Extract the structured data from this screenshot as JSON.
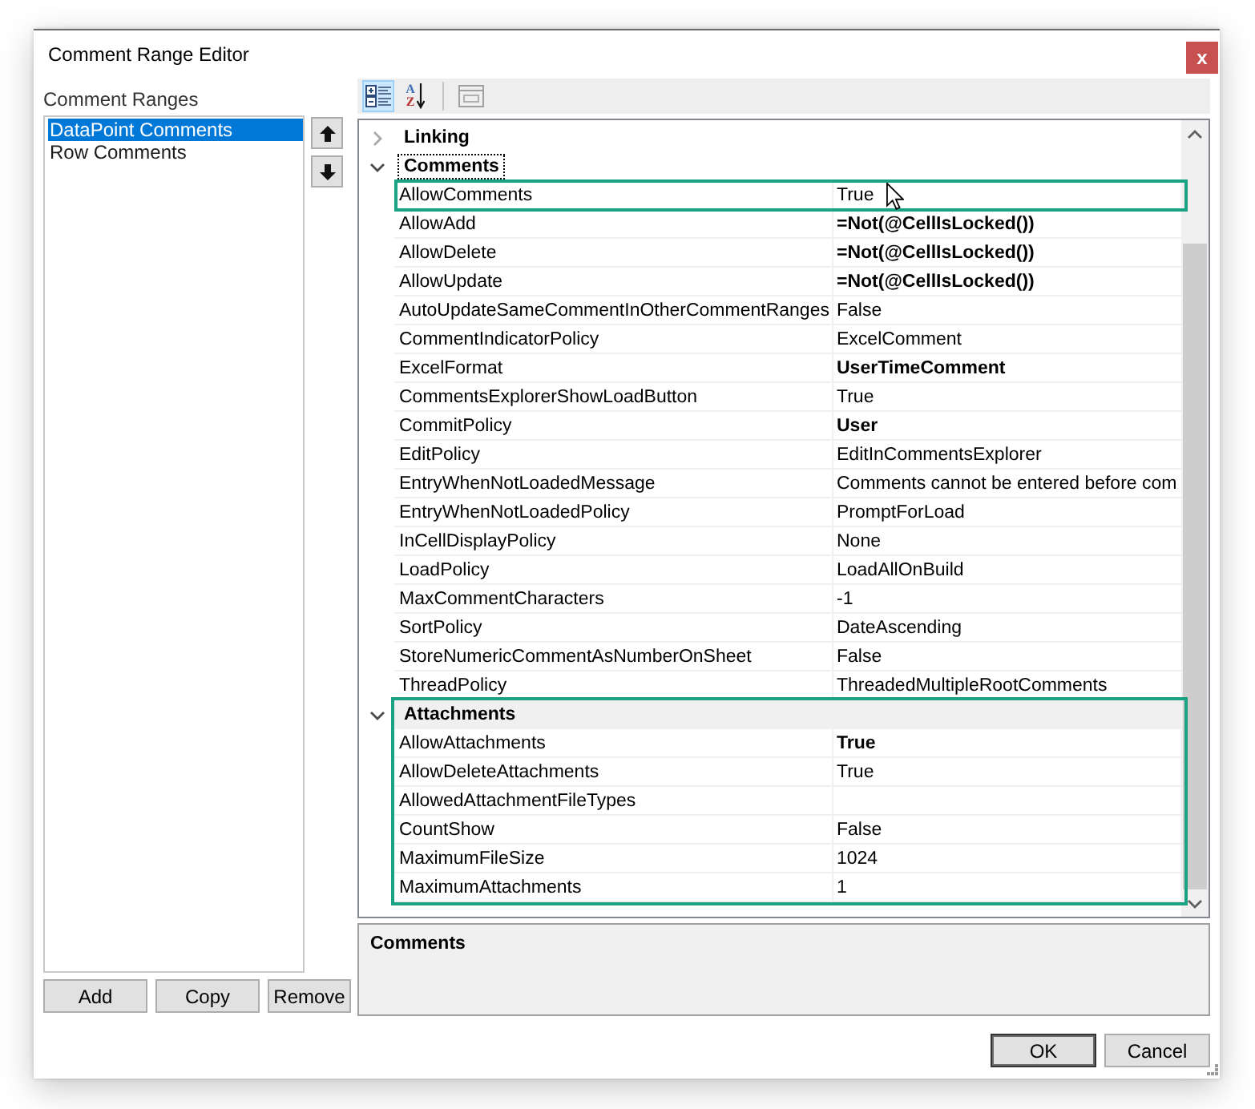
{
  "window": {
    "title": "Comment Range Editor",
    "close_button": "x"
  },
  "comment_ranges": {
    "label": "Comment Ranges",
    "items": [
      {
        "label": "DataPoint Comments",
        "selected": true
      },
      {
        "label": "Row Comments",
        "selected": false
      }
    ],
    "buttons": [
      "Add",
      "Copy",
      "Remove"
    ]
  },
  "toolbar": [
    {
      "kind": "categorized",
      "selected": true,
      "disabled": false
    },
    {
      "kind": "alphabetical",
      "selected": false,
      "disabled": false,
      "glyphs": [
        "A",
        "Z"
      ]
    },
    {
      "kind": "property_pages",
      "selected": false,
      "disabled": true
    }
  ],
  "property_grid": {
    "categories": [
      {
        "name": "Linking",
        "expanded": false,
        "focused": false,
        "shaded": false,
        "highlighted": false
      },
      {
        "name": "Comments",
        "expanded": true,
        "focused": true,
        "shaded": false,
        "highlighted": false,
        "properties": [
          {
            "name": "AllowComments",
            "value": "True",
            "modified": false,
            "highlighted": true
          },
          {
            "name": "AllowAdd",
            "value": "=Not(@CellIsLocked())",
            "modified": true,
            "highlighted": false
          },
          {
            "name": "AllowDelete",
            "value": "=Not(@CellIsLocked())",
            "modified": true,
            "highlighted": false
          },
          {
            "name": "AllowUpdate",
            "value": "=Not(@CellIsLocked())",
            "modified": true,
            "highlighted": false
          },
          {
            "name": "AutoUpdateSameCommentInOtherCommentRanges",
            "value": "False",
            "modified": false,
            "highlighted": false
          },
          {
            "name": "CommentIndicatorPolicy",
            "value": "ExcelComment",
            "modified": false,
            "highlighted": false
          },
          {
            "name": "ExcelFormat",
            "value": "UserTimeComment",
            "modified": true,
            "highlighted": false
          },
          {
            "name": "CommentsExplorerShowLoadButton",
            "value": "True",
            "modified": false,
            "highlighted": false
          },
          {
            "name": "CommitPolicy",
            "value": "User",
            "modified": true,
            "highlighted": false
          },
          {
            "name": "EditPolicy",
            "value": "EditInCommentsExplorer",
            "modified": false,
            "highlighted": false
          },
          {
            "name": "EntryWhenNotLoadedMessage",
            "value": "Comments cannot be entered before com",
            "modified": false,
            "highlighted": false
          },
          {
            "name": "EntryWhenNotLoadedPolicy",
            "value": "PromptForLoad",
            "modified": false,
            "highlighted": false
          },
          {
            "name": "InCellDisplayPolicy",
            "value": "None",
            "modified": false,
            "highlighted": false
          },
          {
            "name": "LoadPolicy",
            "value": "LoadAllOnBuild",
            "modified": false,
            "highlighted": false
          },
          {
            "name": "MaxCommentCharacters",
            "value": "-1",
            "modified": false,
            "highlighted": false
          },
          {
            "name": "SortPolicy",
            "value": "DateAscending",
            "modified": false,
            "highlighted": false
          },
          {
            "name": "StoreNumericCommentAsNumberOnSheet",
            "value": "False",
            "modified": false,
            "highlighted": false
          },
          {
            "name": "ThreadPolicy",
            "value": "ThreadedMultipleRootComments",
            "modified": false,
            "highlighted": false
          }
        ]
      },
      {
        "name": "Attachments",
        "expanded": true,
        "focused": false,
        "shaded": true,
        "highlighted": true,
        "properties": [
          {
            "name": "AllowAttachments",
            "value": "True",
            "modified": true,
            "highlighted": false
          },
          {
            "name": "AllowDeleteAttachments",
            "value": "True",
            "modified": false,
            "highlighted": false
          },
          {
            "name": "AllowedAttachmentFileTypes",
            "highlighted": false
          },
          {
            "name": "CountShow",
            "value": "False",
            "modified": false,
            "highlighted": false
          },
          {
            "name": "MaximumFileSize",
            "value": "1024",
            "modified": false,
            "highlighted": false
          },
          {
            "name": "MaximumAttachments",
            "value": "1",
            "modified": false,
            "highlighted": false
          }
        ]
      }
    ]
  },
  "description": {
    "title": "Comments"
  },
  "buttons": [
    {
      "label": "OK",
      "default": true
    },
    {
      "label": "Cancel",
      "default": false
    }
  ]
}
